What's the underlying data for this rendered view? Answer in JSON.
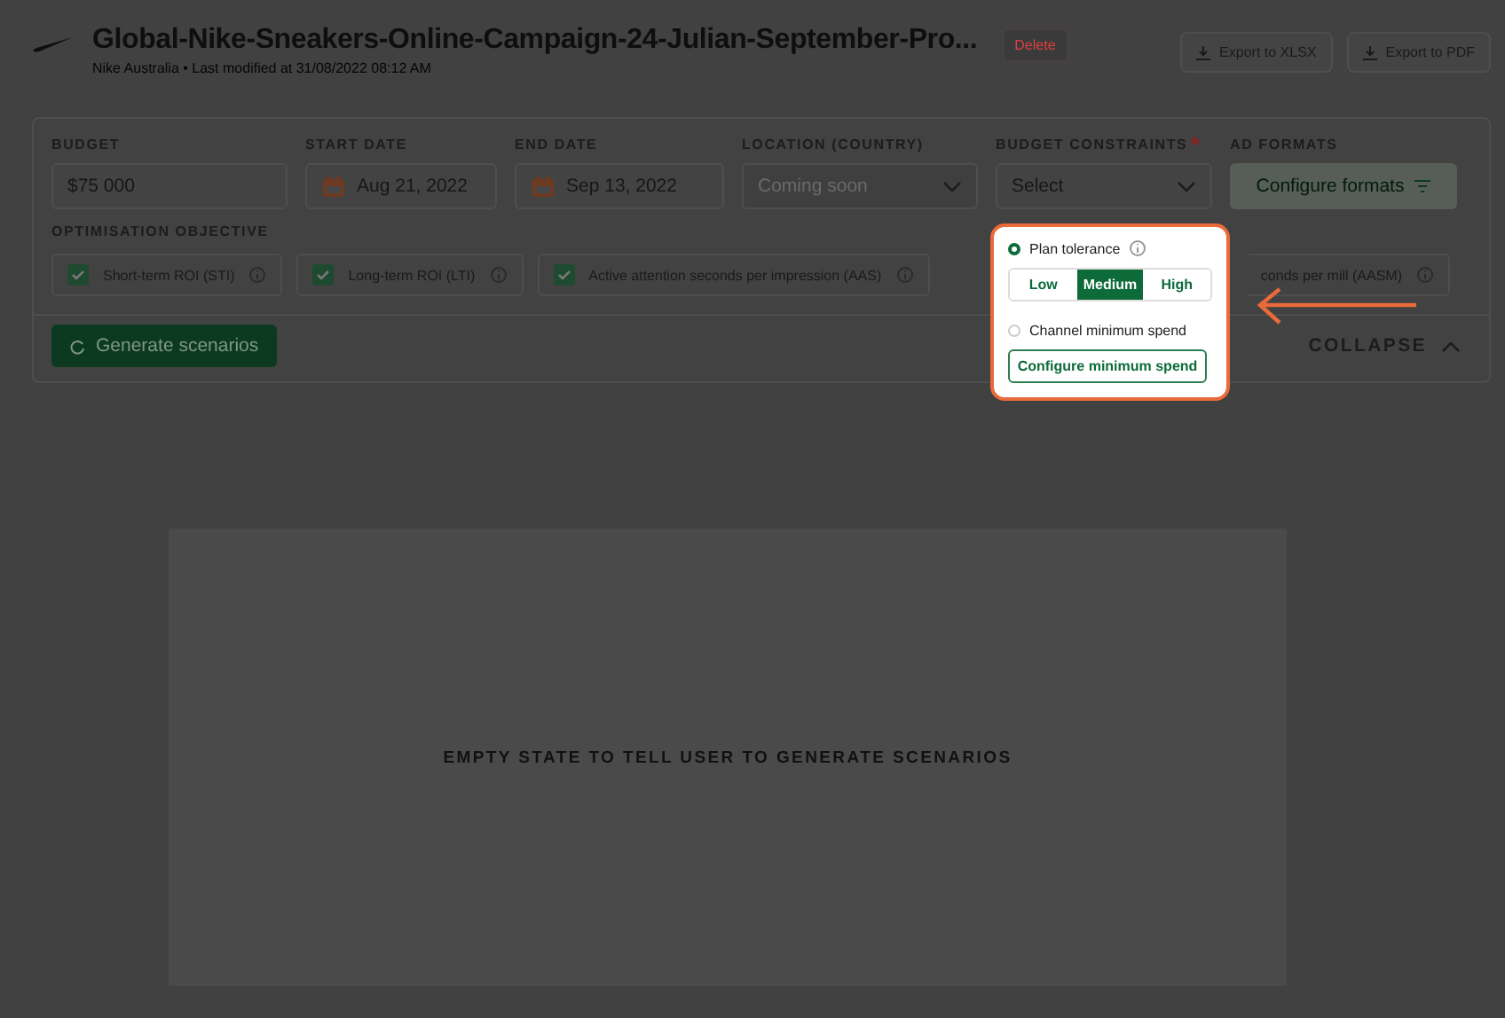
{
  "header": {
    "title": "Global-Nike-Sneakers-Online-Campaign-24-Julian-September-Pro...",
    "subtitle": "Nike Australia • Last modified at 31/08/2022 08:12 AM",
    "delete_label": "Delete",
    "exports": [
      "Export to XLSX",
      "Export to PDF"
    ]
  },
  "filters": [
    {
      "label": "BUDGET",
      "required": false,
      "kind": "text",
      "value": "$75 000"
    },
    {
      "label": "START DATE",
      "required": false,
      "kind": "date",
      "value": "Aug 21, 2022"
    },
    {
      "label": "END DATE",
      "required": false,
      "kind": "date",
      "value": "Sep 13, 2022"
    },
    {
      "label": "LOCATION (COUNTRY)",
      "required": false,
      "kind": "select",
      "value": "Coming soon",
      "disabled": true
    },
    {
      "label": "BUDGET CONSTRAINTS",
      "required": true,
      "kind": "select",
      "value": "Select",
      "disabled": false
    },
    {
      "label": "AD FORMATS",
      "required": false,
      "kind": "button",
      "value": "Configure formats"
    }
  ],
  "objective": {
    "label": "OPTIMISATION OBJECTIVE",
    "options": [
      {
        "label": "Short-term ROI (STI)",
        "kind": "check",
        "checked": true
      },
      {
        "label": "Long-term ROI (LTI)",
        "kind": "check",
        "checked": true
      },
      {
        "label": "Active attention seconds per impression (AAS)",
        "kind": "check",
        "checked": true
      },
      {
        "label": "conds per mill (AASM)",
        "kind": "partial"
      }
    ]
  },
  "generate_label": "Generate scenarios",
  "collapse_label": "COLLAPSE",
  "empty_state": "EMPTY STATE TO TELL USER TO GENERATE SCENARIOS",
  "popover": {
    "options": [
      {
        "label": "Plan tolerance",
        "selected": true,
        "kind": "tolerance",
        "levels": [
          {
            "label": "Low",
            "selected": false
          },
          {
            "label": "Medium",
            "selected": true
          },
          {
            "label": "High",
            "selected": false
          }
        ]
      },
      {
        "label": "Channel minimum spend",
        "selected": false,
        "kind": "action",
        "action": "Configure minimum spend"
      }
    ]
  }
}
